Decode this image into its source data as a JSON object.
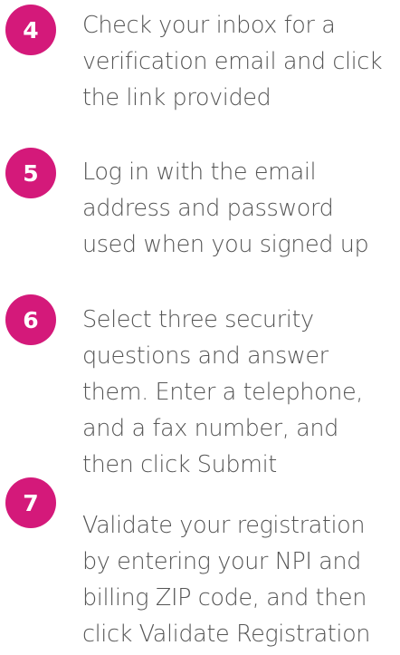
{
  "colors": {
    "badge": "#d4197a",
    "text": "#555555",
    "background": "#ffffff"
  },
  "steps": [
    {
      "number": "4",
      "lines": [
        "Check your inbox for a",
        "verification email and click",
        "the link provided"
      ]
    },
    {
      "number": "5",
      "lines": [
        "Log in with the email",
        "address and password",
        "used when you signed up"
      ]
    },
    {
      "number": "6",
      "lines": [
        "Select three security",
        "questions and answer",
        "them. Enter a telephone,",
        "and a fax number, and",
        "then click Submit"
      ]
    },
    {
      "number": "7",
      "lines": [
        "Validate your registration",
        "by entering your NPI and",
        "billing ZIP code, and then",
        "click Validate Registration"
      ]
    }
  ]
}
